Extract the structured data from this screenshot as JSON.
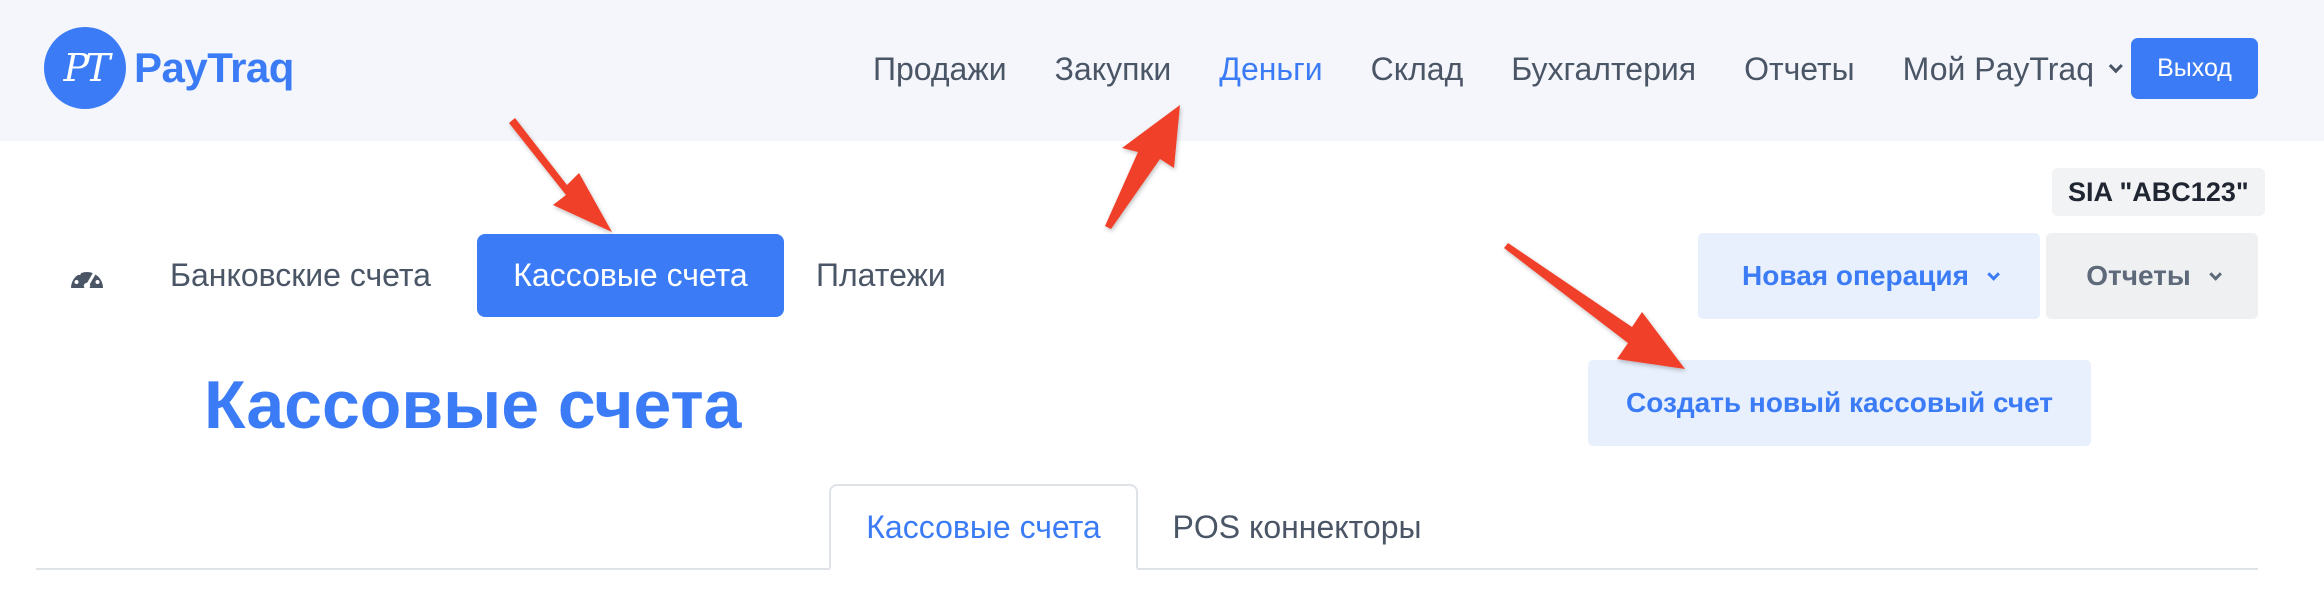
{
  "brand": {
    "logo_mark": "PT",
    "name": "PayTraq"
  },
  "main_nav": {
    "items": [
      "Продажи",
      "Закупки",
      "Деньги",
      "Склад",
      "Бухгалтерия",
      "Отчеты",
      "Мой PayTraq"
    ],
    "active": "Деньги",
    "logout_label": "Выход"
  },
  "company": "SIA \"ABC123\"",
  "sub_nav": {
    "items": [
      "Банковские счета",
      "Кассовые счета",
      "Платежи"
    ],
    "active": "Кассовые счета"
  },
  "actions": {
    "new_operation": "Новая операция",
    "reports": "Отчеты",
    "create_cash_account": "Создать новый кассовый счет"
  },
  "page_title": "Кассовые счета",
  "tabs": {
    "items": [
      "Кассовые счета",
      "POS коннекторы"
    ],
    "active": "Кассовые счета"
  },
  "colors": {
    "accent": "#3b7cf6",
    "topbar_bg": "#f4f6fb",
    "annotation_arrow": "#f0412a"
  }
}
